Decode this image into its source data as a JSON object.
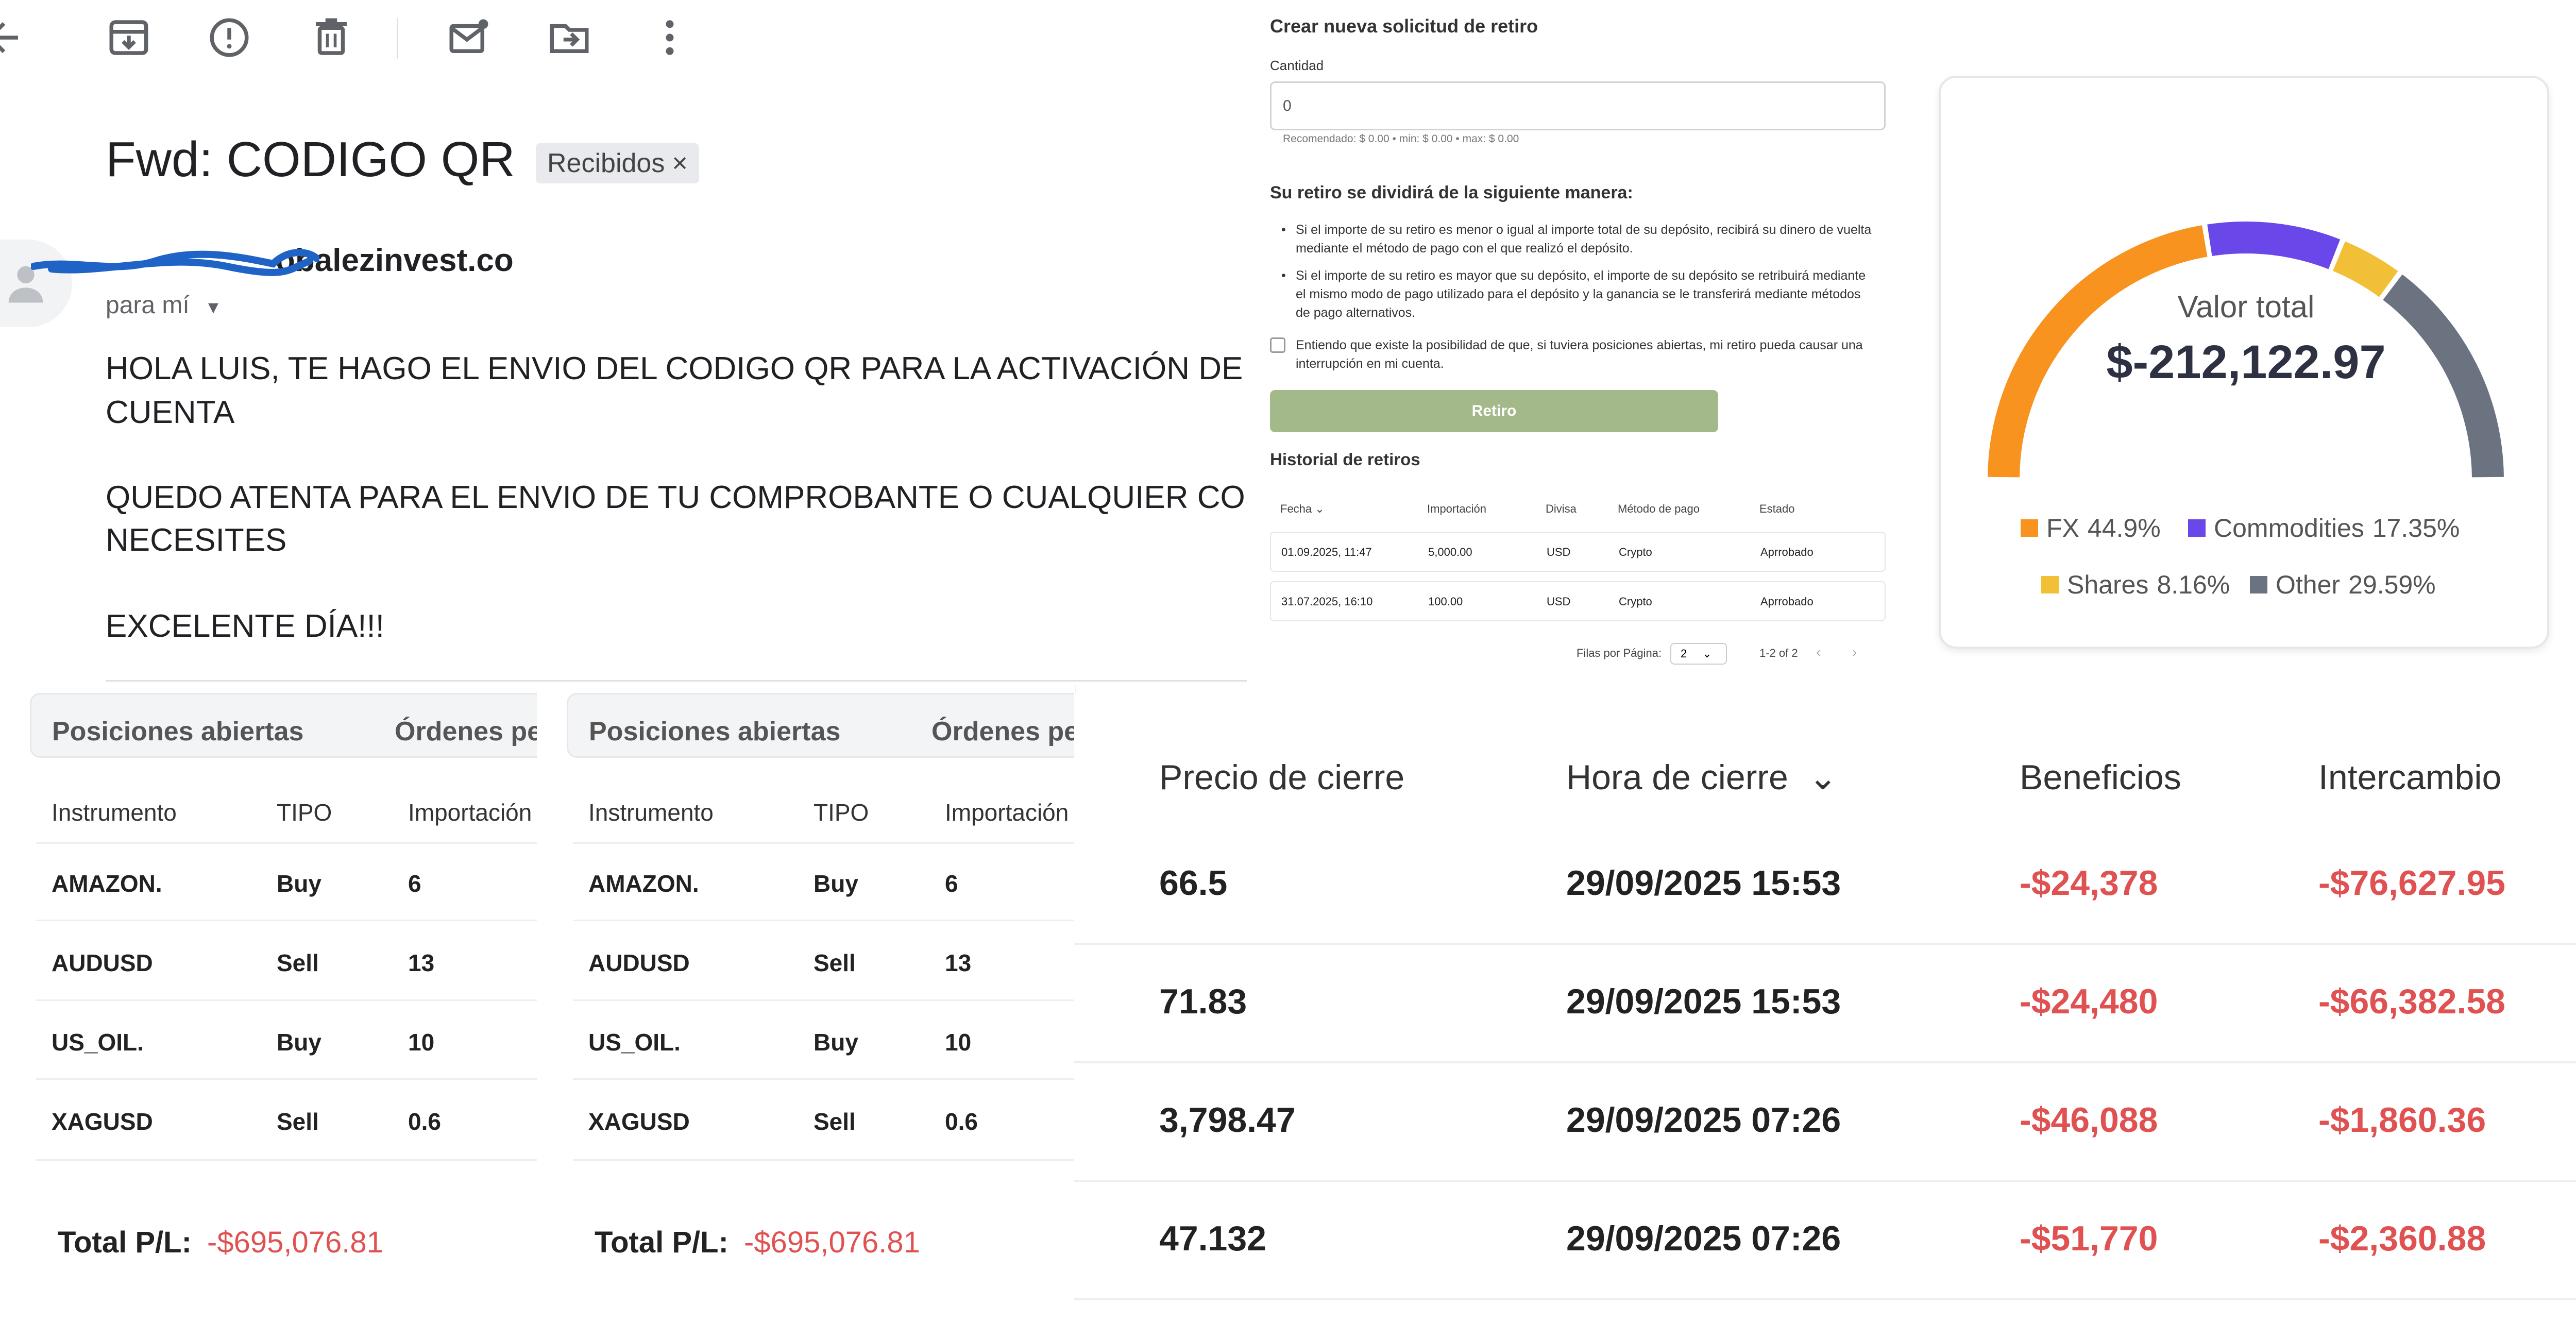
{
  "email": {
    "subject": "Fwd: CODIGO QR",
    "label": "Recibidos",
    "label_close": "×",
    "sender_visible": "obalezinvest.co",
    "recipient": "para mí",
    "body": [
      "HOLA LUIS, TE HAGO EL ENVIO DEL CODIGO QR PARA LA ACTIVACIÓN DE TU",
      "CUENTA",
      "QUEDO ATENTA PARA EL ENVIO DE TU COMPROBANTE O CUALQUIER COSA QU",
      "NECESITES",
      "EXCELENTE DÍA!!!"
    ],
    "toolbar_icons": [
      "back-arrow-icon",
      "archive-icon",
      "report-spam-icon",
      "delete-icon",
      "mark-unread-icon",
      "move-to-icon",
      "more-vert-icon"
    ]
  },
  "withdraw": {
    "title": "Crear nueva solicitud de retiro",
    "qty_label": "Cantidad",
    "qty_value": "0",
    "hint": "Recomendado: $ 0.00 • min: $ 0.00 • max: $ 0.00",
    "split_title": "Su retiro se dividirá de la siguiente manera:",
    "bullets": [
      "Si el importe de su retiro es menor o igual al importe total de su depósito, recibirá su dinero de vuelta mediante el método de pago con el que realizó el depósito.",
      "Si el importe de su retiro es mayor que su depósito, el importe de su depósito se retribuirá mediante el mismo modo de pago utilizado para el depósito y la ganancia se le transferirá mediante métodos de pago alternativos."
    ],
    "checkbox_label": "Entiendo que existe la posibilidad de que, si tuviera posiciones abiertas, mi retiro pueda causar una interrupción en mi cuenta.",
    "submit_label": "Retiro",
    "history_title": "Historial de retiros",
    "headers": [
      "Fecha",
      "Importación",
      "Divisa",
      "Método de pago",
      "Estado"
    ],
    "rows": [
      [
        "01.09.2025, 11:47",
        "5,000.00",
        "USD",
        "Crypto",
        "Aprrobado"
      ],
      [
        "31.07.2025, 16:10",
        "100.00",
        "USD",
        "Crypto",
        "Aprrobado"
      ]
    ],
    "pager_label": "Filas por Página:",
    "rows_per_page": "2",
    "range": "1-2 of 2"
  },
  "donut": {
    "label": "Valor total",
    "value": "$-212,122.97",
    "segments": [
      {
        "name": "FX",
        "pct_label": "44.9%",
        "value": 44.9,
        "color": "#f7931e"
      },
      {
        "name": "Commodities",
        "pct_label": "17.35%",
        "value": 17.35,
        "color": "#6a47e8"
      },
      {
        "name": "Shares",
        "pct_label": "8.16%",
        "value": 8.16,
        "color": "#f2c037"
      },
      {
        "name": "Other",
        "pct_label": "29.59%",
        "value": 29.59,
        "color": "#6b7280"
      }
    ]
  },
  "positions": {
    "tabs": [
      "Posiciones abiertas",
      "Órdenes pe"
    ],
    "headers": [
      "Instrumento",
      "TIPO",
      "Importación"
    ],
    "rows": [
      [
        "AMAZON.",
        "Buy",
        "6"
      ],
      [
        "AUDUSD",
        "Sell",
        "13"
      ],
      [
        "US_OIL.",
        "Buy",
        "10"
      ],
      [
        "XAGUSD",
        "Sell",
        "0.6"
      ]
    ],
    "total_label": "Total P/L:",
    "total_value": "-$695,076.81"
  },
  "closed": {
    "headers": [
      "Precio de cierre",
      "Hora de cierre",
      "Beneficios",
      "Intercambio"
    ],
    "rows": [
      [
        "66.5",
        "29/09/2025 15:53",
        "-$24,378",
        "-$76,627.95"
      ],
      [
        "71.83",
        "29/09/2025 15:53",
        "-$24,480",
        "-$66,382.58"
      ],
      [
        "3,798.47",
        "29/09/2025 07:26",
        "-$46,088",
        "-$1,860.36"
      ],
      [
        "47.132",
        "29/09/2025 07:26",
        "-$51,770",
        "-$2,360.88"
      ]
    ]
  }
}
